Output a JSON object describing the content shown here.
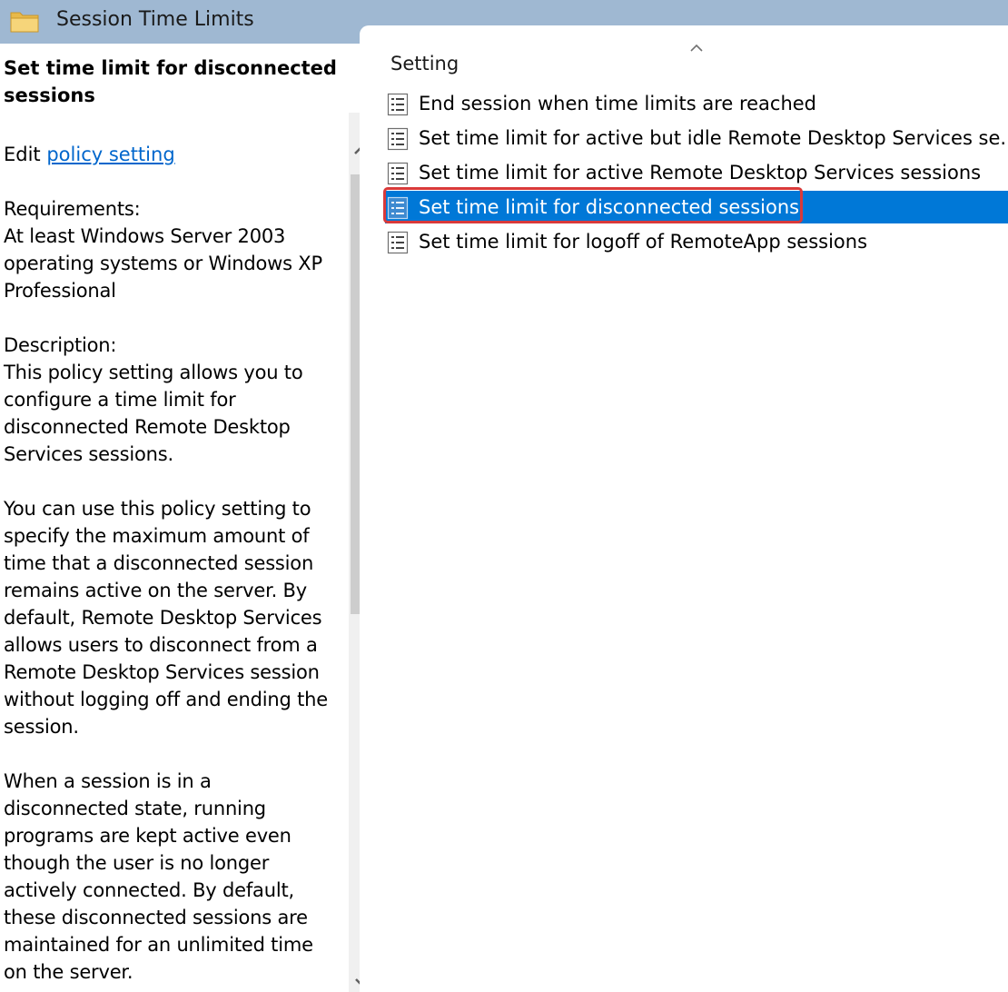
{
  "window": {
    "title": "Session Time Limits"
  },
  "description": {
    "title": "Set time limit for disconnected sessions",
    "edit_prefix": "Edit ",
    "edit_link": "policy setting ",
    "body": "Requirements:\nAt least Windows Server 2003 operating systems or Windows XP Professional\n\nDescription:\nThis policy setting allows you to configure a time limit for disconnected Remote Desktop Services sessions.\n\nYou can use this policy setting to specify the maximum amount of time that a disconnected session remains active on the server. By default, Remote Desktop Services allows users to disconnect from a Remote Desktop Services session without logging off and ending the session.\n\nWhen a session is in a disconnected state, running programs are kept active even though the user is no longer actively connected. By default, these disconnected sessions are maintained for an unlimited time on the server."
  },
  "list": {
    "column_header": "Setting",
    "items": [
      {
        "label": "End session when time limits are reached",
        "selected": false
      },
      {
        "label": "Set time limit for active but idle Remote Desktop Services se...",
        "selected": false
      },
      {
        "label": "Set time limit for active Remote Desktop Services sessions",
        "selected": false
      },
      {
        "label": "Set time limit for disconnected sessions",
        "selected": true
      },
      {
        "label": "Set time limit for logoff of RemoteApp sessions",
        "selected": false
      }
    ]
  },
  "colors": {
    "titlebar": "#9fb8d2",
    "selection": "#0078d7",
    "link": "#0066cc",
    "highlight_box": "#d93a3a"
  },
  "icons": [
    "folder-icon",
    "policy-setting-icon",
    "sort-up-icon",
    "scroll-up-arrow-icon",
    "scroll-down-arrow-icon"
  ]
}
